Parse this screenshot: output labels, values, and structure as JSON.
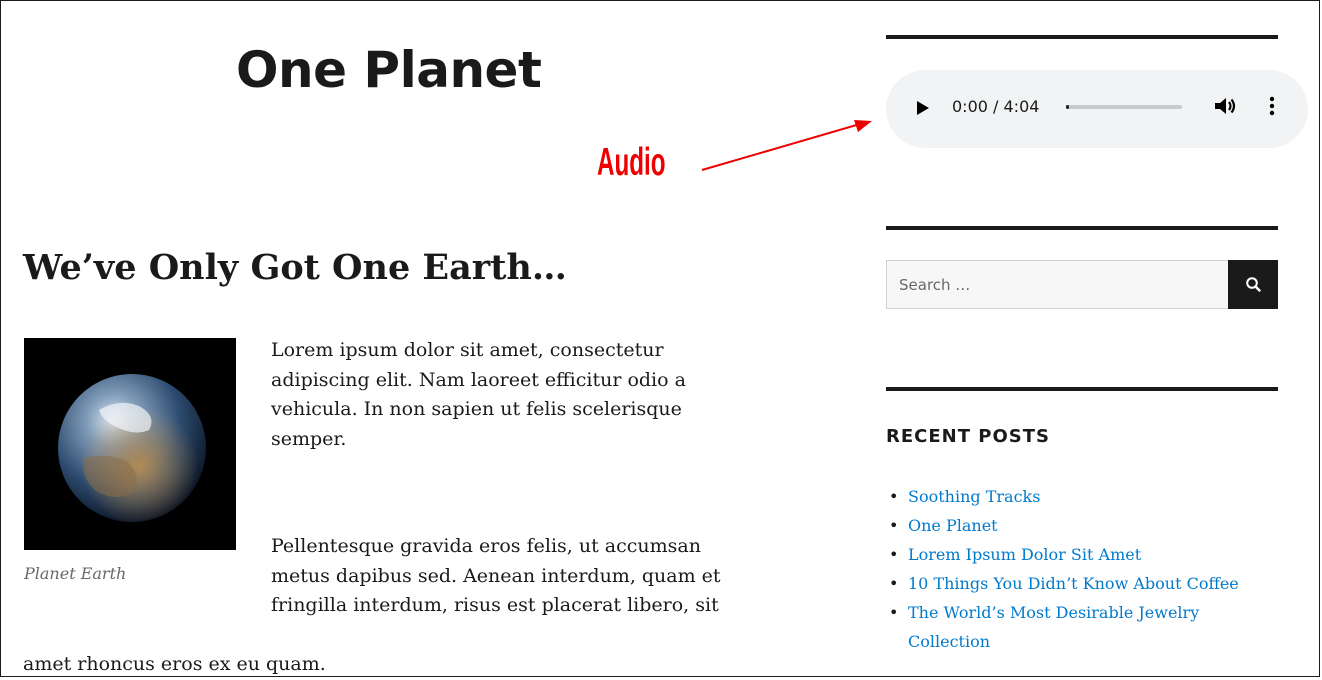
{
  "site": {
    "title": "One Planet"
  },
  "annotation": {
    "label": "Audio",
    "color": "#ee0000"
  },
  "post": {
    "title": "We’ve Only Got One Earth…",
    "image_caption": "Planet Earth",
    "paragraph1_lines": [
      "Lorem ipsum dolor sit amet, consectetur",
      "adipiscing elit. Nam laoreet efficitur odio a",
      "vehicula. In non sapien ut felis scelerisque",
      "semper."
    ],
    "paragraph2_lines": [
      "Pellentesque gravida eros felis, ut accumsan",
      "metus dapibus sed. Aenean interdum, quam et",
      "fringilla interdum, risus est placerat libero, sit",
      "amet rhoncus eros ex eu quam."
    ]
  },
  "audio": {
    "time": "0:00 / 4:04",
    "progress": 0.03
  },
  "search": {
    "placeholder": "Search …",
    "icon": "search-icon"
  },
  "recent_posts": {
    "title": "RECENT POSTS",
    "items": [
      "Soothing Tracks",
      "One Planet",
      "Lorem Ipsum Dolor Sit Amet",
      "10 Things You Didn’t Know About Coffee",
      "The World’s Most Desirable Jewelry",
      "Collection"
    ]
  },
  "colors": {
    "link": "#007acc",
    "text": "#1a1a1a",
    "player_bg": "#f1f3f4"
  }
}
